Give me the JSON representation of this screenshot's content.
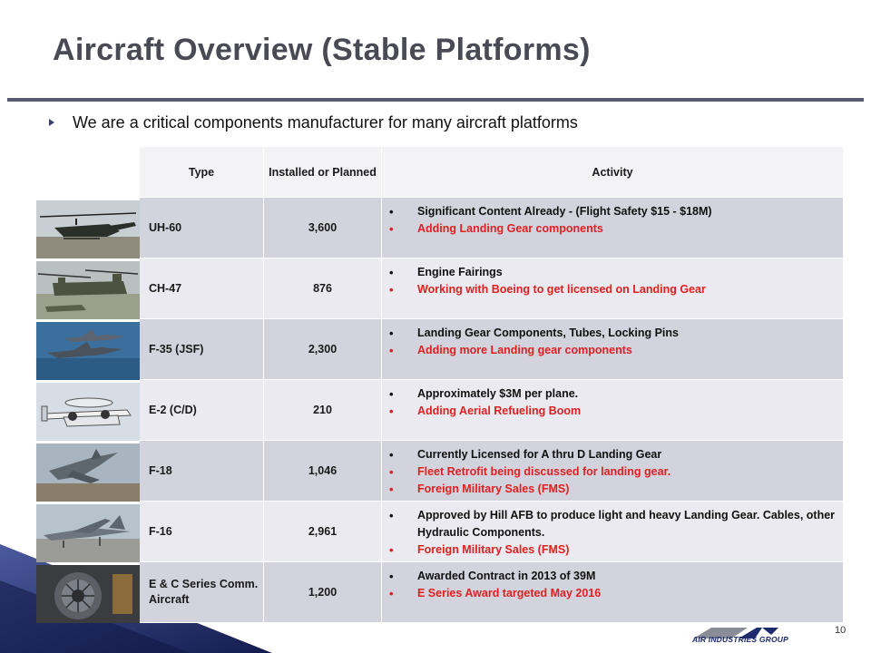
{
  "slide": {
    "title": "Aircraft Overview (Stable Platforms)",
    "bullet": "We are a critical components manufacturer for many aircraft platforms",
    "page_number": "10",
    "logo_text": "AIR INDUSTRIES GROUP"
  },
  "table": {
    "headers": {
      "type": "Type",
      "installed": "Installed or Planned",
      "activity": "Activity"
    },
    "rows": [
      {
        "type": "UH-60",
        "installed": "3,600",
        "thumbnail": "uh60-helicopter-photo",
        "activities": [
          {
            "text": "Significant Content Already - (Flight Safety $15 - $18M)",
            "color": "black"
          },
          {
            "text": "Adding Landing Gear components",
            "color": "red"
          }
        ]
      },
      {
        "type": "CH-47",
        "installed": "876",
        "thumbnail": "ch47-helicopter-photo",
        "activities": [
          {
            "text": "Engine Fairings",
            "color": "black"
          },
          {
            "text": "Working with Boeing to get licensed on Landing Gear",
            "color": "red"
          }
        ]
      },
      {
        "type": "F-35 (JSF)",
        "installed": "2,300",
        "thumbnail": "f35-jets-photo",
        "activities": [
          {
            "text": "Landing Gear Components, Tubes, Locking Pins",
            "color": "black"
          },
          {
            "text": "Adding more Landing gear components",
            "color": "red"
          }
        ]
      },
      {
        "type": "E-2 (C/D)",
        "installed": "210",
        "thumbnail": "e2-hawkeye-photo",
        "activities": [
          {
            "text": "Approximately $3M per plane.",
            "color": "black"
          },
          {
            "text": "Adding Aerial Refueling Boom",
            "color": "red"
          }
        ]
      },
      {
        "type": "F-18",
        "installed": "1,046",
        "thumbnail": "f18-jet-photo",
        "activities": [
          {
            "text": "Currently Licensed for A thru D Landing Gear",
            "color": "black"
          },
          {
            "text": "Fleet Retrofit being discussed for landing gear.",
            "color": "red"
          },
          {
            "text": "Foreign Military Sales (FMS)",
            "color": "red"
          }
        ]
      },
      {
        "type": "F-16",
        "installed": "2,961",
        "thumbnail": "f16-jet-photo",
        "activities": [
          {
            "text": "Approved by Hill AFB to produce light and heavy Landing Gear. Cables, other Hydraulic Components.",
            "color": "black"
          },
          {
            "text": "Foreign Military Sales (FMS)",
            "color": "red"
          }
        ]
      },
      {
        "type": "E & C Series Comm. Aircraft",
        "installed": "1,200",
        "thumbnail": "jet-engine-photo",
        "activities": [
          {
            "text": "Awarded Contract in 2013 of 39M",
            "color": "black"
          },
          {
            "text": "E Series Award targeted May 2016",
            "color": "red"
          }
        ]
      }
    ]
  },
  "colors": {
    "title": "#4a4a54",
    "rule": "#5a5a6e",
    "row_dark": "#d3d3de",
    "row_light": "#eaeaf0",
    "header_bg": "#f3f3f5",
    "accent_red": "#e02020",
    "corner_navy": "#1e2a6b"
  }
}
